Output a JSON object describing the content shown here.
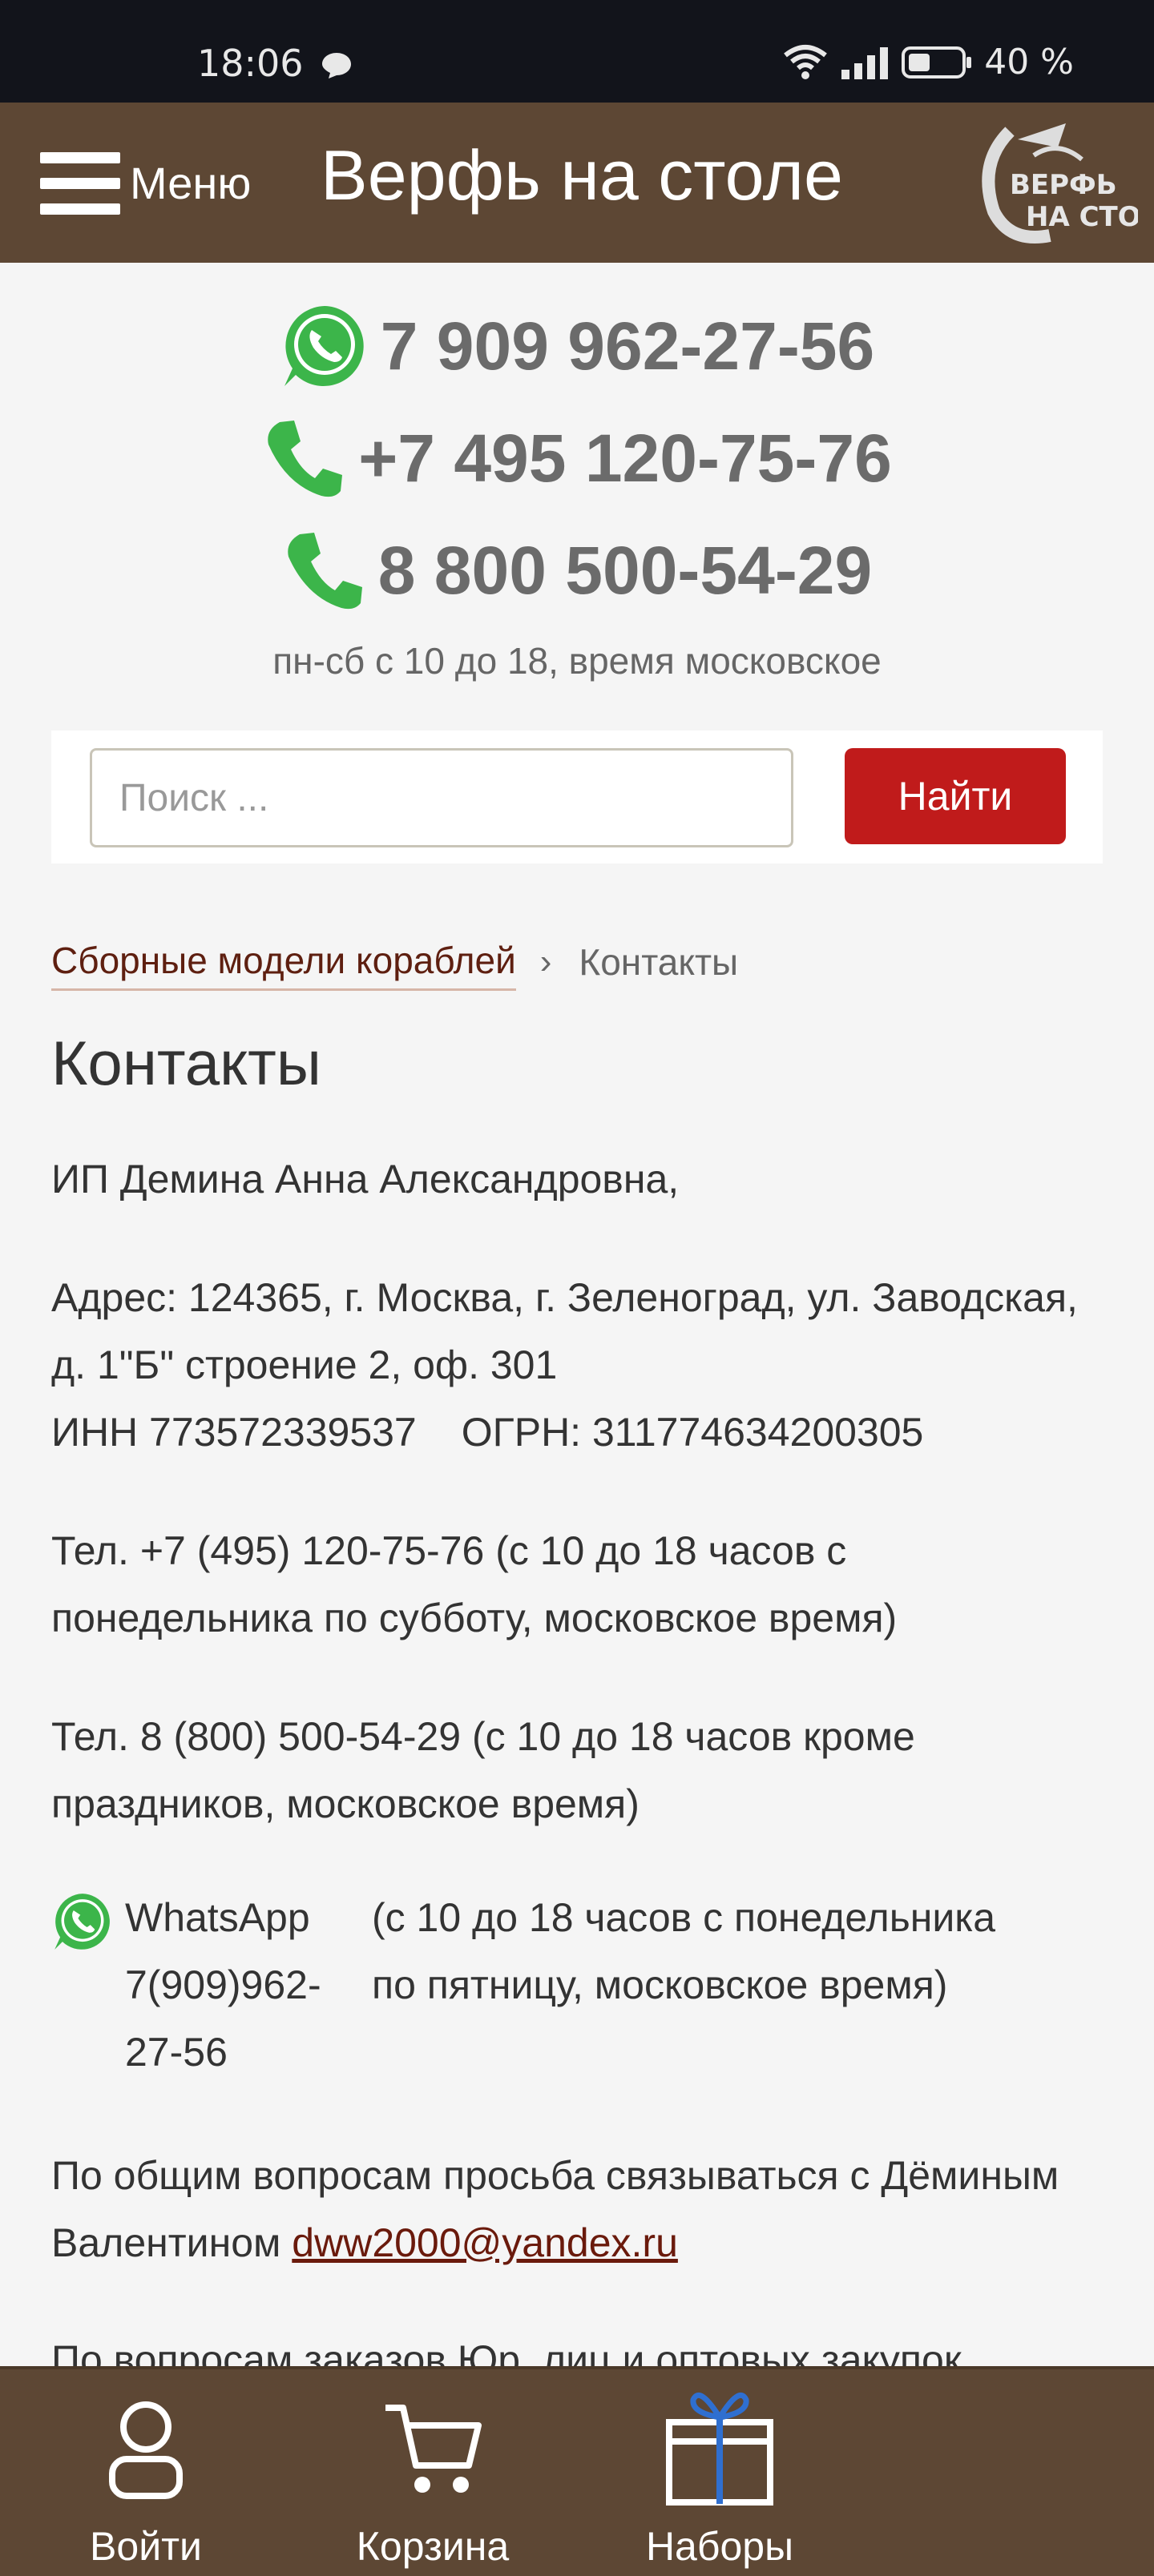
{
  "status_bar": {
    "time": "18:06",
    "battery": "40 %"
  },
  "header": {
    "menu_label": "Меню",
    "title": "Верфь на столе"
  },
  "contacts_top": {
    "whatsapp": "7 909 962-27-56",
    "phone1": "+7 495 120-75-76",
    "phone2": "8 800 500-54-29",
    "hours": "пн-сб с 10 до 18, время московское"
  },
  "search": {
    "placeholder": "Поиск ...",
    "button": "Найти"
  },
  "breadcrumb": {
    "parent": "Сборные модели кораблей",
    "separator": "›",
    "current": "Контакты"
  },
  "page": {
    "title": "Контакты",
    "owner": "ИП Демина Анна Александровна,",
    "address": "Адрес: 124365, г. Москва, г. Зеленоград, ул. Заводская, д. 1\"Б\" строение 2, оф. 301",
    "inn": "ИНН 773572339537",
    "ogrn": "ОГРН: 311774634200305",
    "tel1": "Тел. +7 (495) 120-75-76 (с 10 до 18 часов с понедельника по субботу, московское время)",
    "tel2": "Тел. 8 (800) 500-54-29 (с 10 до 18 часов кроме праздников, московское время)",
    "whatsapp_label": "WhatsApp 7(909)962-27-56",
    "whatsapp_hours": "(с 10 до 18 часов с понедельника по пятницу, московское время)",
    "general_text": "По общим вопросам просьба связываться с Дёминым Валентином",
    "general_email": "dww2000@yandex.ru",
    "cutoff_text": "По вопросам заказов Юр. лиц и оптовых закупок"
  },
  "bottom_nav": {
    "login": "Войти",
    "cart": "Корзина",
    "sets": "Наборы"
  },
  "colors": {
    "brown": "#5d4734",
    "red_button": "#c01b1b",
    "whatsapp_green": "#3cb54a",
    "link": "#6a1a0c"
  }
}
